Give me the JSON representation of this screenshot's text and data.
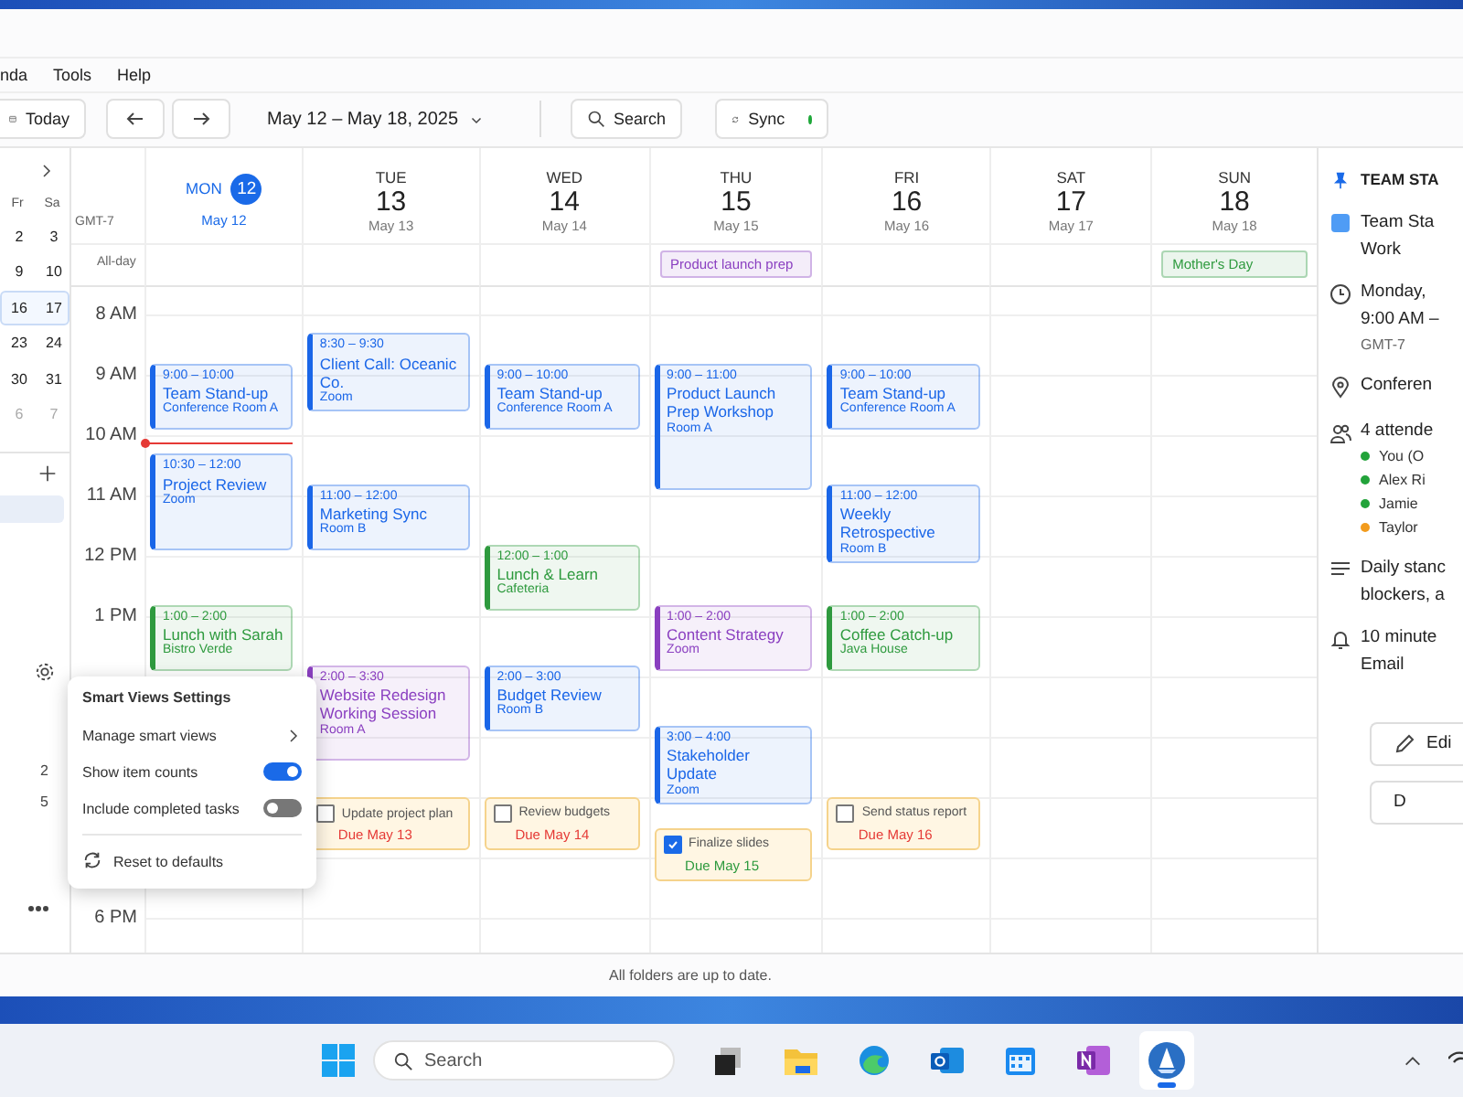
{
  "menu": [
    "nda",
    "Tools",
    "Help"
  ],
  "toolbar": {
    "today": "Today",
    "range": "May 12 – May 18, 2025",
    "search": "Search",
    "sync": "Sync",
    "synced": true
  },
  "mini_calendar": {
    "weekdays": [
      "Fr",
      "Sa"
    ],
    "weeks": [
      {
        "days": [
          "2",
          "3"
        ],
        "selected": false,
        "dimmed": false
      },
      {
        "days": [
          "9",
          "10"
        ],
        "selected": false,
        "dimmed": false
      },
      {
        "days": [
          "16",
          "17"
        ],
        "selected": true,
        "dimmed": false
      },
      {
        "days": [
          "23",
          "24"
        ],
        "selected": false,
        "dimmed": false
      },
      {
        "days": [
          "30",
          "31"
        ],
        "selected": false,
        "dimmed": false
      },
      {
        "days": [
          "6",
          "7"
        ],
        "selected": false,
        "dimmed": true
      }
    ]
  },
  "folders": [
    {
      "selected": true
    }
  ],
  "smart_view_counts": [
    "2",
    "5"
  ],
  "calendar": {
    "timezone": "GMT-7",
    "allday_label": "All-day",
    "hours": [
      "8 AM",
      "9 AM",
      "10 AM",
      "11 AM",
      "12 PM",
      "1 PM",
      "6 PM"
    ],
    "days": [
      {
        "name": "MON",
        "number": "12",
        "date": "May 12",
        "selected": true,
        "items": [
          {
            "kind": "event",
            "time": "9:00 – 10:00",
            "title": "Team Stand-up",
            "place": "Conference Room A",
            "color": "#1a66e8"
          },
          {
            "kind": "event",
            "time": "10:30 – 12:00",
            "title": "Project Review",
            "place": "Zoom",
            "color": "#1a66e8"
          },
          {
            "kind": "event",
            "time": "1:00 – 2:00",
            "title": "Lunch with Sarah",
            "place": "Bistro Verde",
            "color": "#2e9a3e"
          }
        ]
      },
      {
        "name": "TUE",
        "number": "13",
        "date": "May 13",
        "selected": false,
        "items": [
          {
            "kind": "event",
            "time": "8:30 – 9:30",
            "title": "Client Call: Oceanic Co.",
            "place": "Zoom",
            "color": "#1a66e8"
          },
          {
            "kind": "event",
            "time": "11:00 – 12:00",
            "title": "Marketing Sync",
            "place": "Room B",
            "color": "#1a66e8"
          },
          {
            "kind": "event",
            "time": "2:00 – 3:30",
            "title": "Website Redesign Working Session",
            "place": "Room A",
            "color": "#8a3fc0"
          },
          {
            "kind": "task",
            "title": "Update project plan",
            "due": "Due May 13",
            "checked": false
          }
        ]
      },
      {
        "name": "WED",
        "number": "14",
        "date": "May 14",
        "selected": false,
        "items": [
          {
            "kind": "event",
            "time": "9:00 – 10:00",
            "title": "Team Stand-up",
            "place": "Conference Room A",
            "color": "#1a66e8"
          },
          {
            "kind": "event",
            "time": "12:00 – 1:00",
            "title": "Lunch & Learn",
            "place": "Cafeteria",
            "color": "#2e9a3e"
          },
          {
            "kind": "event",
            "time": "2:00 – 3:00",
            "title": "Budget Review",
            "place": "Room B",
            "color": "#1a66e8"
          },
          {
            "kind": "task",
            "title": "Review budgets",
            "due": "Due May 14",
            "checked": false
          }
        ]
      },
      {
        "name": "THU",
        "number": "15",
        "date": "May 15",
        "selected": false,
        "allday": {
          "title": "Product launch prep",
          "color": "#8a3fc0"
        },
        "items": [
          {
            "kind": "event",
            "time": "9:00 – 11:00",
            "title": "Product Launch Prep Workshop",
            "place": "Room A",
            "color": "#1a66e8"
          },
          {
            "kind": "event",
            "time": "1:00 – 2:00",
            "title": "Content Strategy",
            "place": "Zoom",
            "color": "#8a3fc0"
          },
          {
            "kind": "event",
            "time": "3:00 – 4:00",
            "title": "Stakeholder Update",
            "place": "Zoom",
            "color": "#1a66e8"
          },
          {
            "kind": "task",
            "title": "Finalize slides",
            "due": "Due May 15",
            "checked": true
          }
        ]
      },
      {
        "name": "FRI",
        "number": "16",
        "date": "May 16",
        "selected": false,
        "items": [
          {
            "kind": "event",
            "time": "9:00 – 10:00",
            "title": "Team Stand-up",
            "place": "Conference Room A",
            "color": "#1a66e8"
          },
          {
            "kind": "event",
            "time": "11:00 – 12:00",
            "title": "Weekly Retrospective",
            "place": "Room B",
            "color": "#1a66e8"
          },
          {
            "kind": "event",
            "time": "1:00 – 2:00",
            "title": "Coffee Catch-up",
            "place": "Java House",
            "color": "#2e9a3e"
          },
          {
            "kind": "task",
            "title": "Send status report",
            "due": "Due May 16",
            "checked": false
          }
        ]
      },
      {
        "name": "SAT",
        "number": "17",
        "date": "May 17",
        "selected": false
      },
      {
        "name": "SUN",
        "number": "18",
        "date": "May 18",
        "selected": false,
        "allday": {
          "title": "Mother's Day",
          "color": "#2e9a3e"
        }
      }
    ]
  },
  "details": {
    "header": "TEAM STA",
    "title": "Team Sta",
    "calendar": "Work",
    "when": [
      "Monday,",
      "9:00 AM –",
      "GMT-7"
    ],
    "location": "Conferen",
    "attendees_label": "4 attende",
    "attendees": [
      {
        "name": "You (O",
        "color": "#22a33a"
      },
      {
        "name": "Alex Ri",
        "color": "#22a33a"
      },
      {
        "name": "Jamie",
        "color": "#22a33a"
      },
      {
        "name": "Taylor",
        "color": "#f29b1d"
      }
    ],
    "notes": [
      "Daily stanc",
      "blockers, a"
    ],
    "reminder": [
      "10 minute",
      "Email"
    ],
    "buttons": [
      "Edi",
      "D"
    ]
  },
  "popup": {
    "title": "Smart Views Settings",
    "items": [
      {
        "kind": "submenu",
        "label": "Manage smart views"
      },
      {
        "kind": "toggle",
        "label": "Show item counts",
        "on": true
      },
      {
        "kind": "toggle",
        "label": "Include completed tasks",
        "on": false
      },
      {
        "kind": "action",
        "label": "Reset to defaults"
      }
    ]
  },
  "status": "All folders are up to date.",
  "taskbar": {
    "search": "Search",
    "apps": [
      {
        "kind": "taskview",
        "active": false
      },
      {
        "kind": "folder",
        "active": false
      },
      {
        "kind": "browser",
        "active": false
      },
      {
        "kind": "mail",
        "active": false
      },
      {
        "kind": "calendar",
        "active": false
      },
      {
        "kind": "notes",
        "active": false
      },
      {
        "kind": "sail",
        "active": true
      }
    ]
  }
}
